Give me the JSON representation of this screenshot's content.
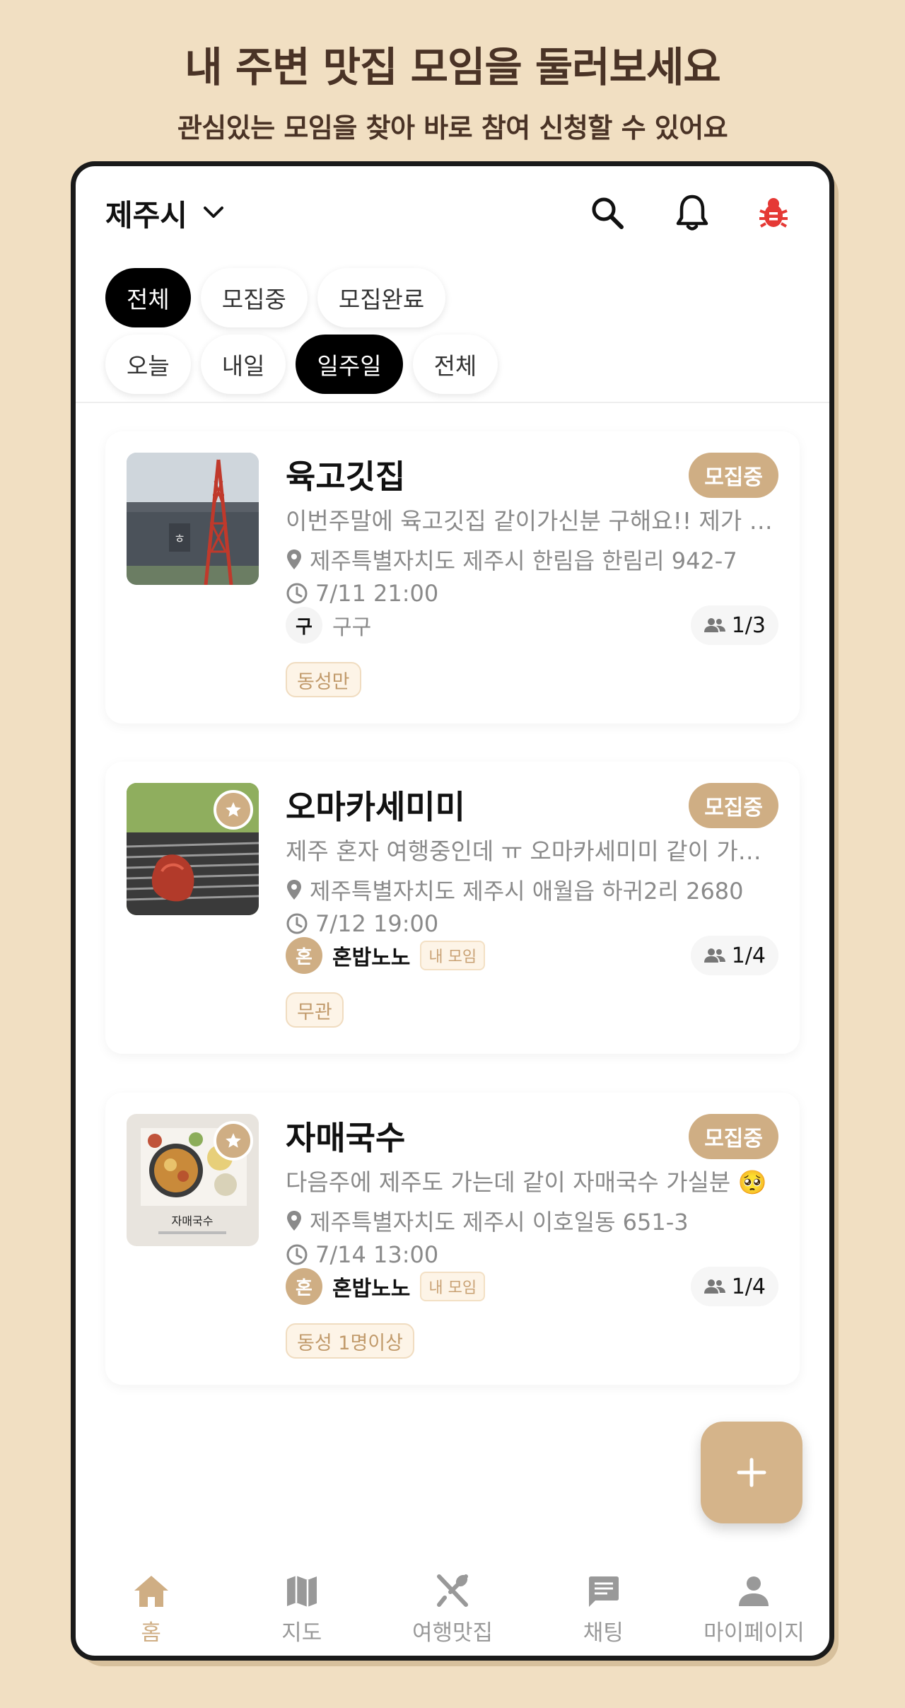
{
  "promo": {
    "headline": "내 주변 맛집 모임을 둘러보세요",
    "subheadline": "관심있는 모임을 찾아 바로 참여 신청할 수 있어요"
  },
  "header": {
    "city": "제주시",
    "icons": [
      "chevron-down-icon",
      "search-icon",
      "bell-icon",
      "bug-icon"
    ]
  },
  "filters": {
    "status": [
      {
        "label": "전체",
        "active": true
      },
      {
        "label": "모집중",
        "active": false
      },
      {
        "label": "모집완료",
        "active": false
      }
    ],
    "period": [
      {
        "label": "오늘",
        "active": false
      },
      {
        "label": "내일",
        "active": false
      },
      {
        "label": "일주일",
        "active": true
      },
      {
        "label": "전체",
        "active": false
      }
    ]
  },
  "meetups": [
    {
      "title": "육고깃집",
      "status": "모집중",
      "description": "이번주말에 육고깃집 같이가신분 구해요!! 제가 고기 잘 구워요",
      "address": "제주특별자치도 제주시 한림읍 한림리 942-7",
      "datetime": "7/11 21:00",
      "host_initial": "구",
      "host_name": "구구",
      "my_meetup": false,
      "my_tag": "",
      "participants": "1/3",
      "tag": "동성만",
      "favorite": false
    },
    {
      "title": "오마카세미미",
      "status": "모집중",
      "description": "제주 혼자 여행중인데 ㅠ 오마카세미미 같이 가실분 있나요",
      "address": "제주특별자치도 제주시 애월읍 하귀2리 2680",
      "datetime": "7/12 19:00",
      "host_initial": "혼",
      "host_name": "혼밥노노",
      "my_meetup": true,
      "my_tag": "내 모임",
      "participants": "1/4",
      "tag": "무관",
      "favorite": true
    },
    {
      "title": "자매국수",
      "status": "모집중",
      "description": "다음주에 제주도 가는데 같이 자매국수 가실분 🥺",
      "address": "제주특별자치도 제주시 이호일동 651-3",
      "datetime": "7/14 13:00",
      "host_initial": "혼",
      "host_name": "혼밥노노",
      "my_meetup": true,
      "my_tag": "내 모임",
      "participants": "1/4",
      "tag": "동성 1명이상",
      "favorite": true
    }
  ],
  "nav": [
    {
      "label": "홈",
      "icon": "home-icon",
      "active": true
    },
    {
      "label": "지도",
      "icon": "map-icon",
      "active": false
    },
    {
      "label": "여행맛집",
      "icon": "utensils-icon",
      "active": false
    },
    {
      "label": "채팅",
      "icon": "chat-icon",
      "active": false
    },
    {
      "label": "마이페이지",
      "icon": "person-icon",
      "active": false
    }
  ],
  "colors": {
    "background": "#f1dfc2",
    "accent": "#cfae84",
    "headline": "#4a3326",
    "bug_icon": "#e53935"
  }
}
